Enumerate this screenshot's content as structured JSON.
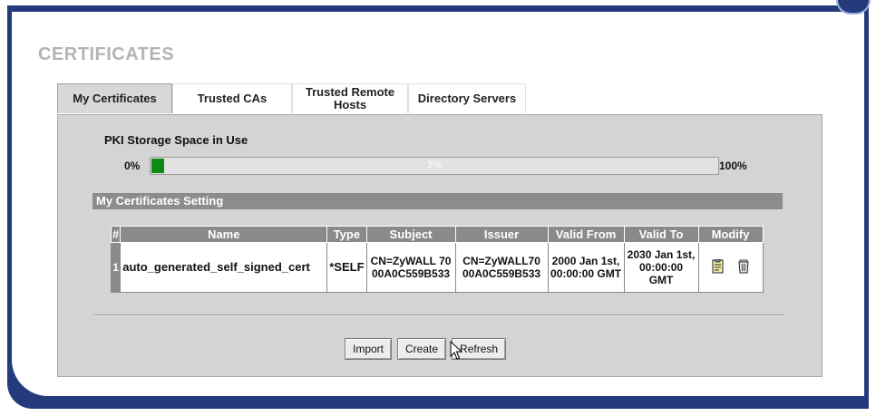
{
  "page": {
    "title": "CERTIFICATES"
  },
  "tabs": [
    {
      "label": "My Certificates",
      "active": true
    },
    {
      "label": "Trusted CAs",
      "active": false
    },
    {
      "label": "Trusted Remote Hosts",
      "active": false
    },
    {
      "label": "Directory Servers",
      "active": false
    }
  ],
  "storage": {
    "label": "PKI Storage Space in Use",
    "min_label": "0%",
    "max_label": "100%",
    "usage_text": "2%",
    "usage_fraction": 0.02,
    "fill_color": "#0b8a14"
  },
  "section": {
    "title": "My Certificates Setting"
  },
  "table": {
    "headers": [
      "#",
      "Name",
      "Type",
      "Subject",
      "Issuer",
      "Valid From",
      "Valid To",
      "Modify"
    ],
    "rows": [
      {
        "index": "1",
        "name": "auto_generated_self_signed_cert",
        "type": "*SELF",
        "subject": "CN=ZyWALL 70 00A0C559B533",
        "issuer": "CN=ZyWALL70 00A0C559B533",
        "valid_from": "2000 Jan 1st, 00:00:00 GMT",
        "valid_to": "2030 Jan 1st, 00:00:00 GMT",
        "modify_icons": [
          "edit-icon",
          "delete-trash-icon"
        ]
      }
    ]
  },
  "buttons": {
    "import": "Import",
    "create": "Create",
    "refresh": "Refresh"
  },
  "colors": {
    "frame": "#243a7a",
    "panel": "#d4d4d4",
    "header": "#8a8a8a",
    "progress": "#0b8a14"
  }
}
